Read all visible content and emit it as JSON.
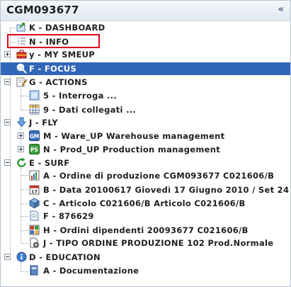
{
  "window": {
    "title": "CGM093677",
    "collapse_icon": "double-chevron-left-icon"
  },
  "tree": {
    "dashboard": "K - DASHBOARD",
    "info": "N - INFO",
    "mysmeup": "y - MY SMEUP",
    "focus": "F - FOCUS",
    "actions": {
      "label": "G - ACTIONS",
      "children": [
        "5 - Interroga ...",
        "9 - Dati collegati ..."
      ]
    },
    "fly": {
      "label": "J - FLY",
      "children": [
        "M - Ware_UP Warehouse management",
        "N - Prod_UP Production management"
      ]
    },
    "surf": {
      "label": "E - SURF",
      "children": [
        "A - Ordine di produzione CGM093677 C021606/B",
        "B - Data 20100617 Giovedì 17 Giugno 2010 / Set 24",
        "C - Articolo C021606/B Articolo C021606/B",
        "F - 876629",
        "H - Ordini dipendenti 20093677 C021606/B",
        "J - TIPO ORDINE PRODUZIONE 102 Prod.Normale"
      ]
    },
    "education": {
      "label": "D - EDUCATION",
      "children": [
        "A - Documentazione"
      ]
    }
  },
  "icon_names": {
    "dashboard": "dashboard-arrow-icon",
    "info": "list-icon",
    "mysmeup": "toolbox-icon",
    "focus": "magnifier-icon",
    "actions": "pencil-note-icon",
    "interroga": "blue-square-icon",
    "dati": "grid-table-icon",
    "fly": "down-arrow-icon",
    "ware": "gm-app-icon",
    "prod": "ps-app-icon",
    "surf": "green-refresh-icon",
    "ordine": "chart-document-icon",
    "data": "calendar-icon",
    "articolo": "cube-icon",
    "f": "document-icon",
    "ordini": "color-grid-icon",
    "tipo": "document-gear-icon",
    "education": "info-icon",
    "documentazione": "book-icon"
  },
  "colors": {
    "selection": "#3166b8",
    "highlight_border": "#e0001b"
  }
}
